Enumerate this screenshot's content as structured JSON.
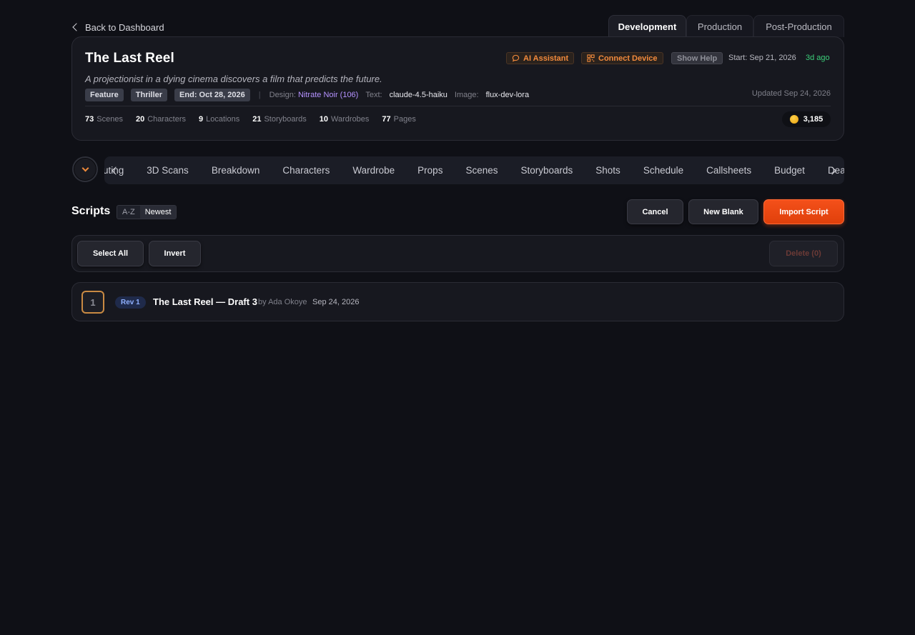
{
  "nav": {
    "back_label": "Back to Dashboard"
  },
  "phase_tabs": [
    {
      "label": "Development",
      "active": true
    },
    {
      "label": "Production",
      "active": false
    },
    {
      "label": "Post-Production",
      "active": false
    }
  ],
  "project": {
    "title": "The Last Reel",
    "logline": "A projectionist in a dying cinema discovers a film that predicts the future.",
    "chips": [
      "Feature",
      "Thriller",
      "End: Oct 28, 2026"
    ],
    "design_label": "Design:",
    "design_value": "Nitrate Noir (106)",
    "text_label": "Text:",
    "text_value": "claude-4.5-haiku",
    "image_label": "Image:",
    "image_value": "flux-dev-lora",
    "start": "Start: Sep 21, 2026",
    "ago": "3d ago",
    "updated": "Updated Sep 24, 2026",
    "actions": {
      "ai_assistant": "AI Assistant",
      "connect_device": "Connect Device",
      "show_help": "Show Help"
    },
    "stats": [
      {
        "num": "73",
        "label": "Scenes"
      },
      {
        "num": "20",
        "label": "Characters"
      },
      {
        "num": "9",
        "label": "Locations"
      },
      {
        "num": "21",
        "label": "Storyboards"
      },
      {
        "num": "10",
        "label": "Wardrobes"
      },
      {
        "num": "77",
        "label": "Pages"
      }
    ],
    "credits": "3,185",
    "colors": {
      "accent": "#f28a3c",
      "design": "#b592ff",
      "ago": "#3ccf7a"
    }
  },
  "modules": {
    "partial_left": "uting",
    "items": [
      "3D Scans",
      "Breakdown",
      "Characters",
      "Wardrobe",
      "Props",
      "Scenes",
      "Storyboards",
      "Shots",
      "Schedule",
      "Callsheets",
      "Budget"
    ],
    "partial_right": "Deals"
  },
  "scripts": {
    "title": "Scripts",
    "sort_options": [
      {
        "label": "A-Z",
        "active": false
      },
      {
        "label": "Newest",
        "active": true
      }
    ],
    "buttons": {
      "cancel": "Cancel",
      "new_blank": "New Blank",
      "import": "Import Script"
    },
    "selection": {
      "select_all": "Select All",
      "invert": "Invert",
      "delete": "Delete (0)"
    },
    "rows": [
      {
        "number": "1",
        "revision": "Rev 1",
        "title": "The Last Reel — Draft 3",
        "by": "by Ada Okoye",
        "date": "Sep 24, 2026"
      }
    ]
  },
  "colors": {
    "background": "#0f1016",
    "primary_button": "#f4501a"
  }
}
